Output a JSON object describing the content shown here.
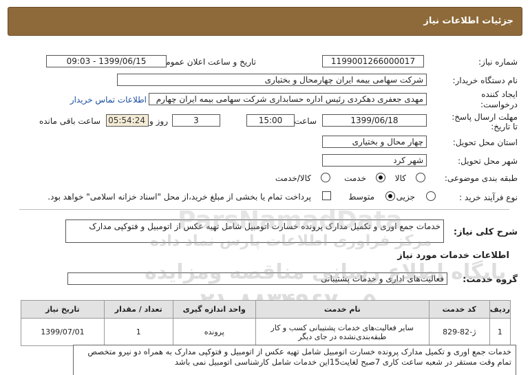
{
  "header": {
    "title": "جزئیات اطلاعات نیاز"
  },
  "form": {
    "need_number_label": "شماره نیاز:",
    "need_number": "1199001266000017",
    "announce_label": "تاریخ و ساعت اعلان عمومی:",
    "announce_value": "1399/06/15 - 09:03",
    "buyer_label": "نام دستگاه خریدار:",
    "buyer_value": "شرکت سهامی بیمه ایران چهارمحال و بختیاری",
    "creator_label_1": "ایجاد کننده",
    "creator_label_2": "درخواست:",
    "creator_value": "مهدی جعفری دهکردی رئیس اداره حسابداری شرکت سهامی بیمه ایران چهارم",
    "contact_link": "اطلاعات تماس خریدار",
    "deadline_label_1": "مهلت ارسال پاسخ:",
    "deadline_label_2": "تا تاریخ:",
    "deadline_date": "1399/06/18",
    "time_label": "ساعت",
    "deadline_time": "15:00",
    "days_value": "3",
    "days_label": "روز و",
    "remaining_time": "05:54:24",
    "remaining_label": "ساعت باقی مانده",
    "province_label": "استان محل تحویل:",
    "province_value": "چهار محال و بختیاری",
    "city_label": "شهر محل تحویل:",
    "city_value": "شهر کرد",
    "category_label": "طبقه بندی موضوعی:",
    "category_options": [
      "کالا",
      "خدمت",
      "کالا/خدمت"
    ],
    "category_selected": "خدمت",
    "process_label": "نوع فرآیند خرید :",
    "process_options": [
      "جزیی",
      "متوسط"
    ],
    "process_selected": "متوسط",
    "payment_note": "پرداخت تمام یا بخشی از مبلغ خرید،از محل \"اسناد خزانه اسلامی\" خواهد بود."
  },
  "summary": {
    "label": "شرح کلی نیاز:",
    "value": "خدمات جمع اوری و تکمیل مدارک پرونده خسارت اتومبیل شامل تهیه عکس از اتومبیل و فتوکپی مدارک"
  },
  "services_section": {
    "title": "اطلاعات خدمات مورد نیاز",
    "group_label": "گروه خدمت:",
    "group_value": "فعالیت‌های اداری و خدمات پشتیبانی"
  },
  "table": {
    "headers": [
      "ردیف",
      "کد خدمت",
      "نام خدمت",
      "واحد اندازه گیری",
      "تعداد / مقدار",
      "تاریخ نیاز"
    ],
    "rows": [
      {
        "row": "1",
        "code": "ژ-82-829",
        "name": "سایر فعالیت‌های خدمات پشتیبانی کسب و کار طبقه‌بندی‌نشده در جای دیگر",
        "unit": "پرونده",
        "qty": "1",
        "date": "1399/07/01"
      }
    ]
  },
  "description": "خدمات جمع اوری و تکمیل مدارک پرونده خسارت اتومبیل شامل تهیه عکس از اتومبیل و فتوکپی مدارک به همراه دو نیرو متخصص  تمام وقت مستقر در شعبه  ساعت کاری 7صبح لغایت15این خدمات شامل کارشناسی اتومبیل نمی باشد",
  "watermark": {
    "brand": "ParsNamadData",
    "line1": "مرکز فراوری اطلاعات پارس نماد داده",
    "line2": "پایگاه اطلاع رسانی مناقصه ومزایده",
    "phone": "۰۲۱-۸۸۳۴۹۶۷۰-۵"
  }
}
